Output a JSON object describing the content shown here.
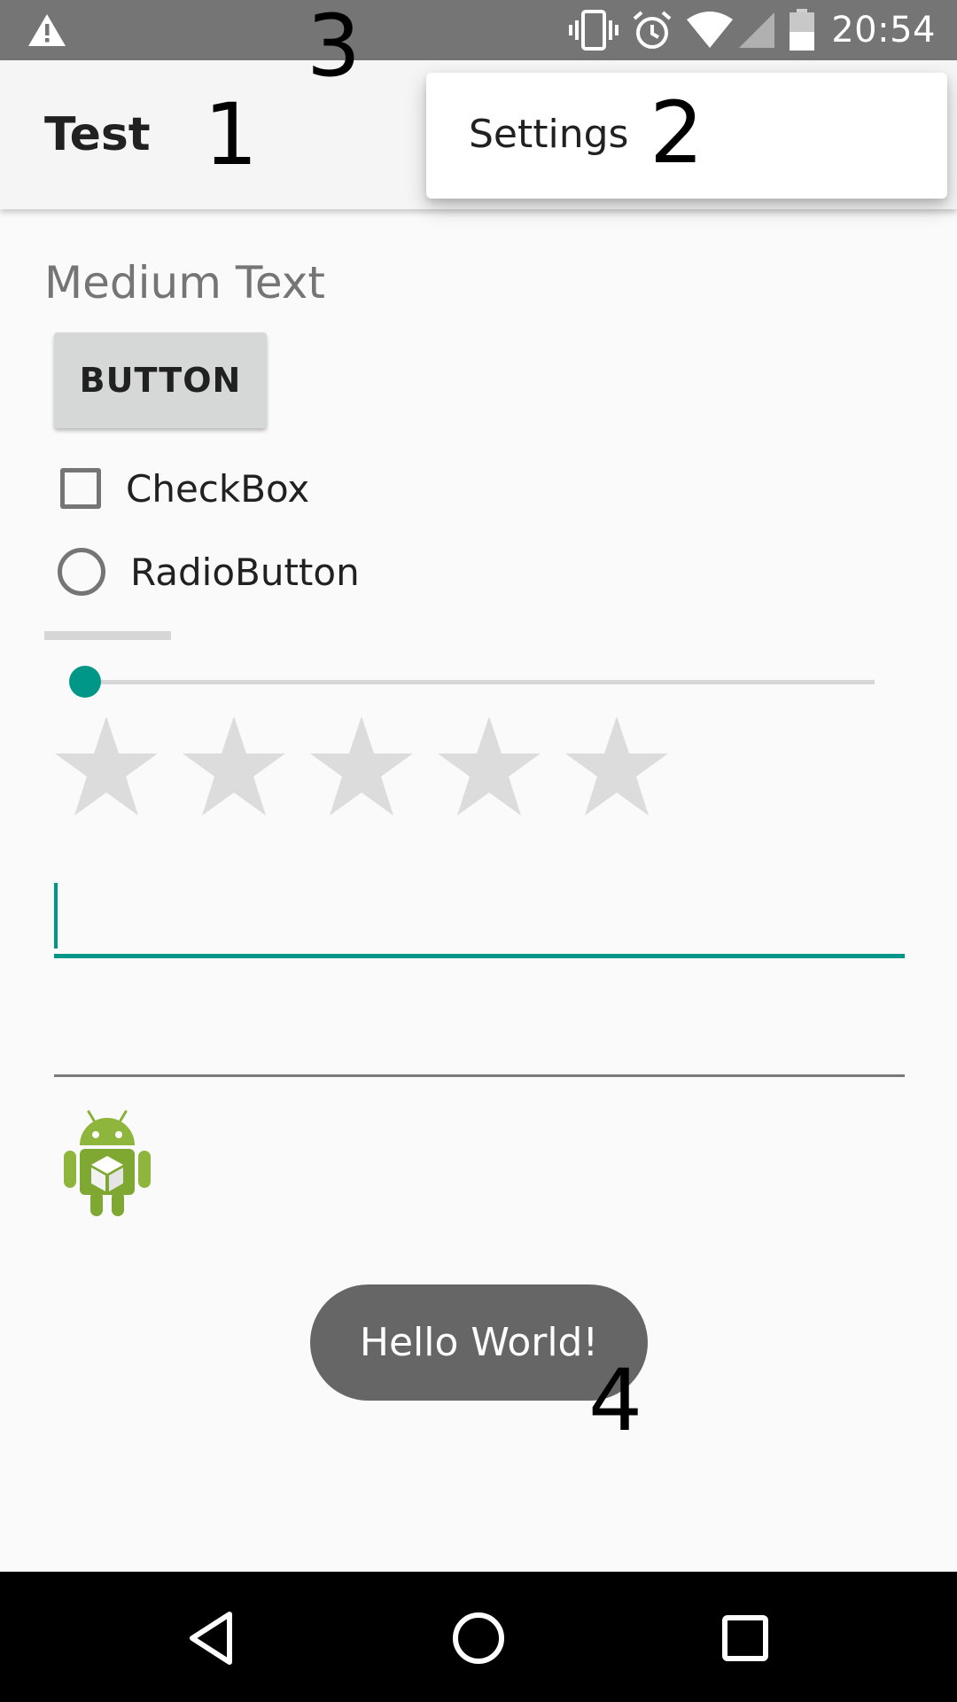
{
  "status_bar": {
    "time": "20:54",
    "icons": [
      "warning-icon",
      "vibrate-icon",
      "alarm-icon",
      "wifi-icon",
      "signal-icon",
      "battery-icon"
    ]
  },
  "app_bar": {
    "title": "Test"
  },
  "popup_menu": {
    "items": [
      {
        "label": "Settings"
      }
    ]
  },
  "annotations": [
    "1",
    "2",
    "3",
    "4"
  ],
  "content": {
    "medium_text": "Medium Text",
    "button_label": "BUTTON",
    "checkbox_label": "CheckBox",
    "checkbox_checked": false,
    "radio_label": "RadioButton",
    "radio_checked": false,
    "seekbar_value": 0,
    "rating_value": 0,
    "rating_max": 5,
    "edit_text_1_value": "",
    "edit_text_2_value": "",
    "image_icon": "android-robot-icon"
  },
  "toast": {
    "message": "Hello World!"
  },
  "nav_bar": {
    "buttons": [
      "back-icon",
      "home-icon",
      "recents-icon"
    ]
  },
  "colors": {
    "accent": "#009688",
    "status_bar": "#757575",
    "app_bar": "#f5f5f5",
    "toast": "#666666",
    "nav_bar": "#000000"
  }
}
